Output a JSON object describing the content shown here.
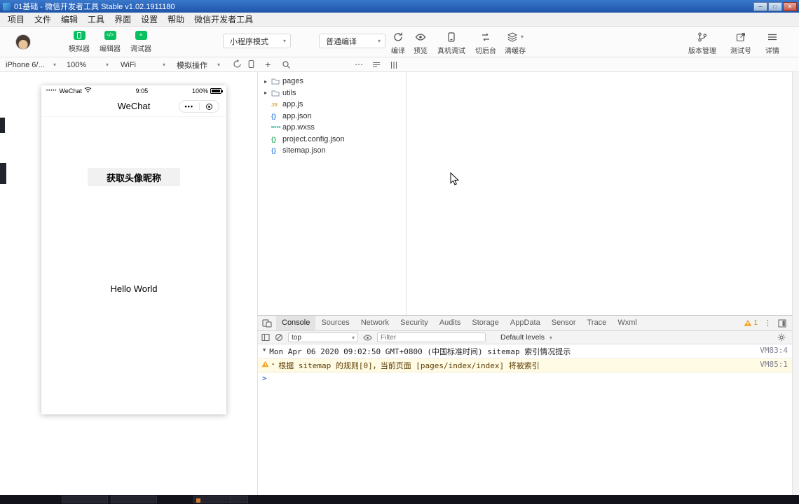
{
  "window": {
    "title": "01基础 - 微信开发者工具 Stable v1.02.1911180",
    "controls": {
      "minimize": "─",
      "maximize": "□",
      "close": "✕"
    }
  },
  "menu": {
    "items": [
      "项目",
      "文件",
      "编辑",
      "工具",
      "界面",
      "设置",
      "帮助",
      "微信开发者工具"
    ]
  },
  "toolbar": {
    "toggles": [
      {
        "label": "模拟器"
      },
      {
        "label": "编辑器"
      },
      {
        "label": "调试器"
      }
    ],
    "mode_dropdown": "小程序模式",
    "compile_dropdown": "普通编译",
    "actions": [
      {
        "label": "编译"
      },
      {
        "label": "预览"
      },
      {
        "label": "真机调试"
      },
      {
        "label": "切后台"
      },
      {
        "label": "清缓存"
      }
    ],
    "right_actions": [
      {
        "label": "版本管理"
      },
      {
        "label": "测试号"
      },
      {
        "label": "详情"
      }
    ]
  },
  "simulator_bar": {
    "device": "iPhone 6/...",
    "zoom": "100%",
    "network": "WiFi",
    "operation": "模拟操作"
  },
  "phone": {
    "carrier": "WeChat",
    "time": "9:05",
    "battery_percent": "100%",
    "nav_title": "WeChat",
    "button_label": "获取头像昵称",
    "body_text": "Hello World"
  },
  "file_tree": {
    "items": [
      {
        "name": "pages"
      },
      {
        "name": "utils"
      },
      {
        "name": "app.js",
        "badge": "JS"
      },
      {
        "name": "app.json",
        "badge": "{}"
      },
      {
        "name": "app.wxss",
        "badge": "wxss"
      },
      {
        "name": "project.config.json",
        "badge": "{}"
      },
      {
        "name": "sitemap.json",
        "badge": "{}"
      }
    ]
  },
  "devtools": {
    "tabs": [
      "Console",
      "Sources",
      "Network",
      "Security",
      "Audits",
      "Storage",
      "AppData",
      "Sensor",
      "Trace",
      "Wxml"
    ],
    "active_tab": "Console",
    "warning_count": "1",
    "toolbar": {
      "context": "top",
      "filter_placeholder": "Filter",
      "levels": "Default levels"
    },
    "messages": [
      {
        "text": "Mon Apr 06 2020 09:02:50 GMT+0800 (中国标准时间) sitemap 索引情况提示",
        "source": "VM83:4"
      },
      {
        "text": "根据 sitemap 的规则[0]，当前页面 [pages/index/index] 将被索引",
        "source": "VM85:1"
      }
    ]
  },
  "icons": {
    "caret_down": "▾",
    "caret_right": "▸",
    "caret_expanded": "▼",
    "plus": "+",
    "more_horizontal": "⋯",
    "more_vertical": "⋮",
    "prompt_chevron": ">",
    "capsule_dots": "•••",
    "signal_dots": "•••••",
    "editor_code": "</>",
    "debugger_lines": "≡"
  },
  "colors": {
    "wechat_green": "#07c160",
    "titlebar_blue": "#2a63b8",
    "warning_bg": "#fffbe5",
    "warning_text": "#5c3c00",
    "warning_icon": "#f0a62c"
  }
}
